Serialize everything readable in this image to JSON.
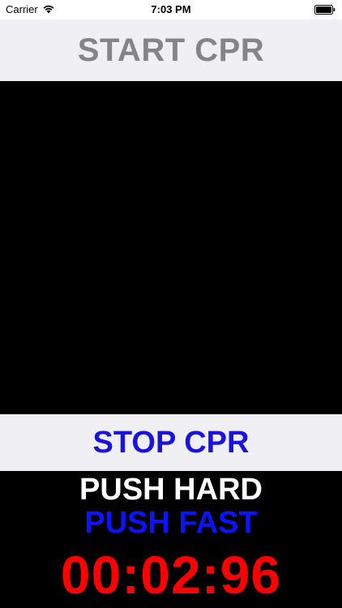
{
  "status_bar": {
    "carrier": "Carrier",
    "time": "7:03 PM",
    "wifi_icon": "wifi-icon",
    "battery_icon": "battery-icon"
  },
  "header": {
    "start_label": "START CPR",
    "start_color": "#858585"
  },
  "controls": {
    "stop_label": "STOP CPR",
    "stop_color": "#1a12e0"
  },
  "prompts": {
    "push_hard": "PUSH HARD",
    "push_hard_color": "#ffffff",
    "push_fast": "PUSH FAST",
    "push_fast_color": "#0a14ff"
  },
  "timer": {
    "value": "00:02:96",
    "color": "#ff0000"
  }
}
